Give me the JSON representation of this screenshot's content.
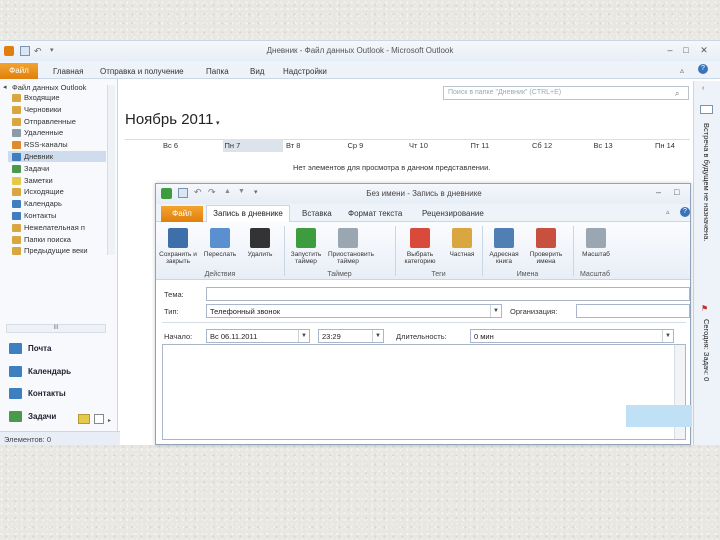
{
  "main_window": {
    "title": "Дневник - Файл данных Outlook - Microsoft Outlook",
    "menu": {
      "file": "Файл",
      "items": [
        "Главная",
        "Отправка и получение",
        "Папка",
        "Вид",
        "Надстройки"
      ]
    }
  },
  "nav": {
    "root": "Файл данных Outlook",
    "folders": [
      {
        "label": "Входящие",
        "color": "#d9a640"
      },
      {
        "label": "Черновики",
        "color": "#d9a640"
      },
      {
        "label": "Отправленные",
        "color": "#d9a640"
      },
      {
        "label": "Удаленные",
        "color": "#8d9aa8"
      },
      {
        "label": "RSS-каналы",
        "color": "#e08a2c"
      },
      {
        "label": "Дневник",
        "color": "#3f7fbf"
      },
      {
        "label": "Задачи",
        "color": "#4b9a4b"
      },
      {
        "label": "Заметки",
        "color": "#e6c94a"
      },
      {
        "label": "Исходящие",
        "color": "#d9a640"
      },
      {
        "label": "Календарь",
        "color": "#3f7fbf"
      },
      {
        "label": "Контакты",
        "color": "#3f7fbf"
      },
      {
        "label": "Нежелательная п",
        "color": "#d9a640"
      },
      {
        "label": "Папки поиска",
        "color": "#d9a640"
      },
      {
        "label": "Предыдущие веки",
        "color": "#d9a640"
      }
    ],
    "selected_index": 5,
    "hscroll_label": "III",
    "sections": [
      {
        "label": "Почта",
        "color": "#3f7fbf"
      },
      {
        "label": "Календарь",
        "color": "#3f7fbf"
      },
      {
        "label": "Контакты",
        "color": "#3f7fbf"
      },
      {
        "label": "Задачи",
        "color": "#4b9a4b"
      },
      {
        "label": "Заметки",
        "color": "#e6c94a"
      }
    ],
    "status": "Элементов: 0"
  },
  "calendar": {
    "search_placeholder": "Поиск в папке \"Дневник\" (CTRL+E)",
    "month": "Ноябрь 2011",
    "days": [
      "Вс 6",
      "Пн 7",
      "Вт 8",
      "Ср 9",
      "Чт 10",
      "Пт 11",
      "Сб 12",
      "Вс 13",
      "Пн 14"
    ],
    "no_items": "Нет элементов для просмотра в данном представлении."
  },
  "todo_bar": {
    "text1": "Встреча в будущем не назначена.",
    "text2": "Сегодня: Задач: 0"
  },
  "appointment": {
    "title": "Без имени - Запись в дневнике",
    "tabs": {
      "file": "Файл",
      "active": "Запись в дневнике",
      "others": [
        "Вставка",
        "Формат текста",
        "Рецензирование"
      ]
    },
    "ribbon_buttons": [
      {
        "label": "Сохранить и закрыть",
        "color": "#3f6fa8"
      },
      {
        "label": "Переслать",
        "color": "#5a8fd0"
      },
      {
        "label": "Удалить",
        "color": "#333333"
      },
      {
        "label": "Запустить таймер",
        "color": "#3d9c3d"
      },
      {
        "label": "Приостановить таймер",
        "color": "#9aa6b2"
      },
      {
        "label": "Выбрать категорию",
        "color": "#d94a3a"
      },
      {
        "label": "Частная",
        "color": "#d9a640"
      },
      {
        "label": "Адресная книга",
        "color": "#4f7fb3"
      },
      {
        "label": "Проверить имена",
        "color": "#c8503f"
      },
      {
        "label": "Масштаб",
        "color": "#9aa6b2"
      }
    ],
    "groups": [
      "Действия",
      "Таймер",
      "Теги",
      "Имена",
      "Масштаб"
    ],
    "form": {
      "subject_label": "Тема:",
      "subject_value": "",
      "type_label": "Тип:",
      "type_value": "Телефонный звонок",
      "company_label": "Организация:",
      "company_value": "",
      "start_label": "Начало:",
      "start_date": "Вс 06.11.2011",
      "start_time": "23:29",
      "duration_label": "Длительность:",
      "duration_value": "0 мин"
    }
  }
}
